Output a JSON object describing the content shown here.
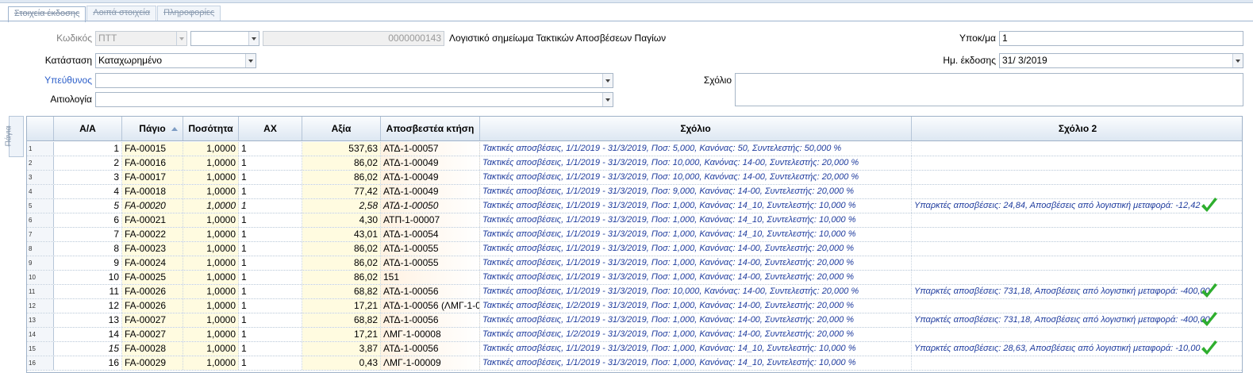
{
  "tabs": [
    "Στοιχεία έκδοσης",
    "Λοιπά στοιχεία",
    "Πληροφορίες"
  ],
  "form": {
    "code_label": "Κωδικός",
    "code_series": "ΠΤΤ",
    "code_second": "",
    "code_number": "0000000143",
    "doc_description": "Λογιστικό σημείωμα Τακτικών Αποσβέσεων Παγίων",
    "branch_label": "Υποκ/μα",
    "branch_value": "1",
    "status_label": "Κατάσταση",
    "status_value": "Καταχωρημένο",
    "date_label": "Ημ. έκδοσης",
    "date_value": "31/ 3/2019",
    "responsible_label": "Υπεύθυνος",
    "responsible_value": "",
    "comment_label": "Σχόλιο",
    "comment_value": "",
    "reason_label": "Αιτιολογία",
    "reason_value": ""
  },
  "side_tab": "Πάγια",
  "grid": {
    "headers": {
      "aa": "Α/Α",
      "asset": "Πάγιο",
      "qty": "Ποσότητα",
      "ax": "ΑΧ",
      "value": "Αξία",
      "acq": "Αποσβεστέα κτήση",
      "comment": "Σχόλιο",
      "comment2": "Σχόλιο 2"
    },
    "rows": [
      {
        "idx": "1",
        "aa": "1",
        "asset": "FA-00015",
        "qty": "1,0000",
        "ax": "1",
        "value": "537,63",
        "acq": "ΑΤΔ-1-00057",
        "comment": "Τακτικές αποσβέσεις, 1/1/2019 - 31/3/2019, Ποσ: 5,000, Κανόνας: 50, Συντελεστής: 50,000 %",
        "comment2": "",
        "check": false,
        "italic": false
      },
      {
        "idx": "2",
        "aa": "2",
        "asset": "FA-00016",
        "qty": "1,0000",
        "ax": "1",
        "value": "86,02",
        "acq": "ΑΤΔ-1-00049",
        "comment": "Τακτικές αποσβέσεις, 1/1/2019 - 31/3/2019, Ποσ: 10,000, Κανόνας: 14-00, Συντελεστής: 20,000 %",
        "comment2": "",
        "check": false,
        "italic": false
      },
      {
        "idx": "3",
        "aa": "3",
        "asset": "FA-00017",
        "qty": "1,0000",
        "ax": "1",
        "value": "86,02",
        "acq": "ΑΤΔ-1-00049",
        "comment": "Τακτικές αποσβέσεις, 1/1/2019 - 31/3/2019, Ποσ: 10,000, Κανόνας: 14-00, Συντελεστής: 20,000 %",
        "comment2": "",
        "check": false,
        "italic": false
      },
      {
        "idx": "4",
        "aa": "4",
        "asset": "FA-00018",
        "qty": "1,0000",
        "ax": "1",
        "value": "77,42",
        "acq": "ΑΤΔ-1-00049",
        "comment": "Τακτικές αποσβέσεις, 1/1/2019 - 31/3/2019, Ποσ: 9,000, Κανόνας: 14-00, Συντελεστής: 20,000 %",
        "comment2": "",
        "check": false,
        "italic": false
      },
      {
        "idx": "5",
        "aa": "5",
        "asset": "FA-00020",
        "qty": "1,0000",
        "ax": "1",
        "value": "2,58",
        "acq": "ΑΤΔ-1-00050",
        "comment": "Τακτικές αποσβέσεις, 1/1/2019 - 31/3/2019, Ποσ: 1,000, Κανόνας: 14_10, Συντελεστής: 10,000 %",
        "comment2": "Υπαρκτές αποσβέσεις: 24,84, Αποσβέσεις από λογιστική μεταφορά: -12,42",
        "check": true,
        "italic": true
      },
      {
        "idx": "6",
        "aa": "6",
        "asset": "FA-00021",
        "qty": "1,0000",
        "ax": "1",
        "value": "4,30",
        "acq": "ΑΤΠ-1-00007",
        "comment": "Τακτικές αποσβέσεις, 1/1/2019 - 31/3/2019, Ποσ: 1,000, Κανόνας: 14_10, Συντελεστής: 10,000 %",
        "comment2": "",
        "check": false,
        "italic": false
      },
      {
        "idx": "7",
        "aa": "7",
        "asset": "FA-00022",
        "qty": "1,0000",
        "ax": "1",
        "value": "43,01",
        "acq": "ΑΤΔ-1-00054",
        "comment": "Τακτικές αποσβέσεις, 1/1/2019 - 31/3/2019, Ποσ: 1,000, Κανόνας: 14_10, Συντελεστής: 10,000 %",
        "comment2": "",
        "check": false,
        "italic": false
      },
      {
        "idx": "8",
        "aa": "8",
        "asset": "FA-00023",
        "qty": "1,0000",
        "ax": "1",
        "value": "86,02",
        "acq": "ΑΤΔ-1-00055",
        "comment": "Τακτικές αποσβέσεις, 1/1/2019 - 31/3/2019, Ποσ: 1,000, Κανόνας: 14-00, Συντελεστής: 20,000 %",
        "comment2": "",
        "check": false,
        "italic": false
      },
      {
        "idx": "9",
        "aa": "9",
        "asset": "FA-00024",
        "qty": "1,0000",
        "ax": "1",
        "value": "86,02",
        "acq": "ΑΤΔ-1-00055",
        "comment": "Τακτικές αποσβέσεις, 1/1/2019 - 31/3/2019, Ποσ: 1,000, Κανόνας: 14-00, Συντελεστής: 20,000 %",
        "comment2": "",
        "check": false,
        "italic": false
      },
      {
        "idx": "10",
        "aa": "10",
        "asset": "FA-00025",
        "qty": "1,0000",
        "ax": "1",
        "value": "86,02",
        "acq": "151",
        "comment": "Τακτικές αποσβέσεις, 1/1/2019 - 31/3/2019, Ποσ: 1,000, Κανόνας: 14-00, Συντελεστής: 20,000 %",
        "comment2": "",
        "check": false,
        "italic": false
      },
      {
        "idx": "11",
        "aa": "11",
        "asset": "FA-00026",
        "qty": "1,0000",
        "ax": "1",
        "value": "68,82",
        "acq": "ΑΤΔ-1-00056",
        "comment": "Τακτικές αποσβέσεις, 1/1/2019 - 31/3/2019, Ποσ: 10,000, Κανόνας: 14-00, Συντελεστής: 20,000 %",
        "comment2": "Υπαρκτές αποσβέσεις: 731,18, Αποσβέσεις από λογιστική μεταφορά: -400,00",
        "check": true,
        "italic": false
      },
      {
        "idx": "12",
        "aa": "12",
        "asset": "FA-00026",
        "qty": "1,0000",
        "ax": "1",
        "value": "17,21",
        "acq": "ΑΤΔ-1-00056 (ΛΜΓ-1-0...",
        "comment": "Τακτικές αποσβέσεις, 1/2/2019 - 31/3/2019, Ποσ: 1,000, Κανόνας: 14-00, Συντελεστής: 20,000 %",
        "comment2": "",
        "check": false,
        "italic": false
      },
      {
        "idx": "13",
        "aa": "13",
        "asset": "FA-00027",
        "qty": "1,0000",
        "ax": "1",
        "value": "68,82",
        "acq": "ΑΤΔ-1-00056",
        "comment": "Τακτικές αποσβέσεις, 1/1/2019 - 31/3/2019, Ποσ: 1,000, Κανόνας: 14-00, Συντελεστής: 20,000 %",
        "comment2": "Υπαρκτές αποσβέσεις: 731,18, Αποσβέσεις από λογιστική μεταφορά: -400,00",
        "check": true,
        "italic": false
      },
      {
        "idx": "14",
        "aa": "14",
        "asset": "FA-00027",
        "qty": "1,0000",
        "ax": "1",
        "value": "17,21",
        "acq": "ΛΜΓ-1-00008",
        "comment": "Τακτικές αποσβέσεις, 1/2/2019 - 31/3/2019, Ποσ: 1,000, Κανόνας: 14-00, Συντελεστής: 20,000 %",
        "comment2": "",
        "check": false,
        "italic": false
      },
      {
        "idx": "15",
        "aa": "15",
        "asset": "FA-00028",
        "qty": "1,0000",
        "ax": "1",
        "value": "3,87",
        "acq": "ΑΤΔ-1-00056",
        "comment": "Τακτικές αποσβέσεις, 1/1/2019 - 31/3/2019, Ποσ: 1,000, Κανόνας: 14_10, Συντελεστής: 10,000 %",
        "comment2": "Υπαρκτές αποσβέσεις: 28,63, Αποσβέσεις από λογιστική μεταφορά: -10,00",
        "check": true,
        "italic": false,
        "aa_italic": true
      },
      {
        "idx": "16",
        "aa": "16",
        "asset": "FA-00029",
        "qty": "1,0000",
        "ax": "1",
        "value": "0,43",
        "acq": "ΛΜΓ-1-00009",
        "comment": "Τακτικές αποσβέσεις, 1/1/2019 - 31/3/2019, Ποσ: 1,000, Κανόνας: 14_10, Συντελεστής: 10,000 %",
        "comment2": "",
        "check": false,
        "italic": false
      }
    ]
  },
  "colors": {
    "accent": "#2b5ec9",
    "comment_text": "#1f3c9e",
    "check": "#2eae2e",
    "qty_bg": "#fffbe0",
    "acq_bg": "#fff2e2"
  }
}
